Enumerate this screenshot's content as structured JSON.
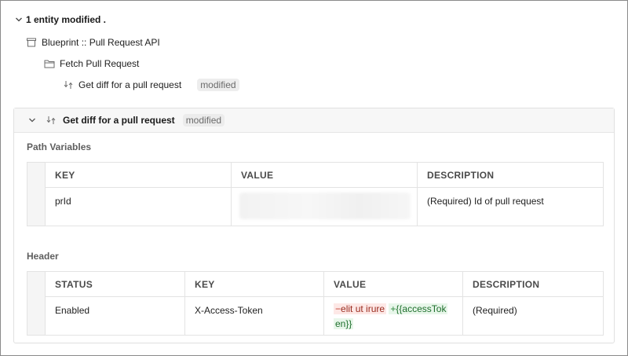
{
  "summary": {
    "label": "1 entity modified ."
  },
  "tree": {
    "collection": "Blueprint :: Pull Request API",
    "folder": "Fetch Pull Request",
    "request": {
      "label": "Get diff for a pull request",
      "badge": "modified"
    }
  },
  "card": {
    "title": "Get diff for a pull request",
    "badge": "modified",
    "path_variables": {
      "label": "Path Variables",
      "columns": [
        "KEY",
        "VALUE",
        "DESCRIPTION"
      ],
      "rows": [
        {
          "key": "prId",
          "value": "",
          "description": "(Required) Id of pull request"
        }
      ]
    },
    "header": {
      "label": "Header",
      "columns": [
        "STATUS",
        "KEY",
        "VALUE",
        "DESCRIPTION"
      ],
      "rows": [
        {
          "status": "Enabled",
          "key": "X-Access-Token",
          "value_removed": "elit ut irure",
          "value_added_1": "{{accessTok",
          "value_added_2": "en}}",
          "sign_removed": "−",
          "sign_added": "+",
          "description": "(Required)"
        }
      ]
    }
  },
  "colors": {
    "diff_removed_bg": "#fde8e6",
    "diff_added_bg": "#e8f6ea",
    "badge_bg": "#ededed"
  },
  "icons": {
    "summary": "chevron-down-icon",
    "collection": "collection-icon",
    "folder": "folder-icon",
    "request": "request-swap-icon"
  }
}
